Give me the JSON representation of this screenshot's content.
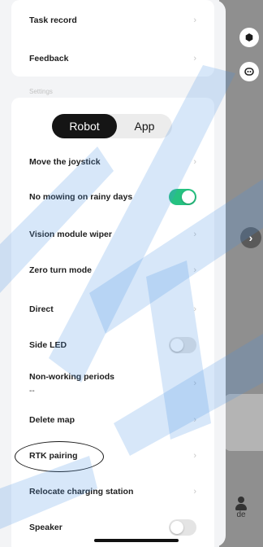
{
  "top_card": {
    "items": [
      {
        "label": "Task record"
      },
      {
        "label": "Feedback"
      }
    ]
  },
  "settings": {
    "section_label": "Settings",
    "segment": {
      "robot": "Robot",
      "app": "App",
      "selected": "Robot"
    },
    "rows": {
      "move_joystick": "Move the joystick",
      "no_mowing_rain": "No mowing on rainy days",
      "vision_wiper": "Vision module wiper",
      "zero_turn": "Zero turn mode",
      "direct": "Direct",
      "side_led": "Side LED",
      "non_working": "Non-working periods",
      "non_working_value": "--",
      "delete_map": "Delete map",
      "rtk_pairing": "RTK pairing",
      "relocate_station": "Relocate charging station",
      "speaker": "Speaker"
    },
    "toggles": {
      "no_mowing_rain": true,
      "side_led": false,
      "speaker": false
    }
  },
  "background": {
    "partial_label": "de"
  },
  "colors": {
    "toggle_on": "#26c281",
    "toggle_off": "#e4e4e4",
    "watermark": "#4a90e2"
  },
  "icons": {
    "chevron": "›",
    "gear": "gear-icon",
    "robot": "robot-icon",
    "arrow": "chevron-right-icon"
  }
}
